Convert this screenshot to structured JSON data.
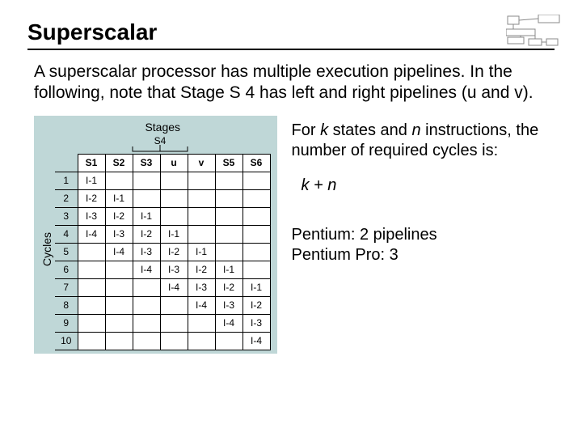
{
  "title": "Superscalar",
  "intro": "A superscalar processor has multiple execution pipelines. In the following, note that Stage S 4 has left and right pipelines (u and v).",
  "diagram": {
    "stages_label": "Stages",
    "cycles_label": "Cycles",
    "s4_label": "S4",
    "columns": [
      "S1",
      "S2",
      "S3",
      "u",
      "v",
      "S5",
      "S6"
    ],
    "cycles": [
      "1",
      "2",
      "3",
      "4",
      "5",
      "6",
      "7",
      "8",
      "9",
      "10"
    ],
    "cells": [
      [
        "I-1",
        "",
        "",
        "",
        "",
        "",
        ""
      ],
      [
        "I-2",
        "I-1",
        "",
        "",
        "",
        "",
        ""
      ],
      [
        "I-3",
        "I-2",
        "I-1",
        "",
        "",
        "",
        ""
      ],
      [
        "I-4",
        "I-3",
        "I-2",
        "I-1",
        "",
        "",
        ""
      ],
      [
        "",
        "I-4",
        "I-3",
        "I-2",
        "I-1",
        "",
        ""
      ],
      [
        "",
        "",
        "I-4",
        "I-3",
        "I-2",
        "I-1",
        ""
      ],
      [
        "",
        "",
        "",
        "I-4",
        "I-3",
        "I-2",
        "I-1"
      ],
      [
        "",
        "",
        "",
        "",
        "I-4",
        "I-3",
        "I-2"
      ],
      [
        "",
        "",
        "",
        "",
        "",
        "I-4",
        "I-3"
      ],
      [
        "",
        "",
        "",
        "",
        "",
        "",
        "I-4"
      ]
    ]
  },
  "side": {
    "p1a": "For ",
    "p1_k": "k",
    "p1b": " states and ",
    "p1_n": "n",
    "p1c": " instructions, the number of required cycles is:",
    "formula": "k + n",
    "pentium1": "Pentium: 2 pipelines",
    "pentium2": "Pentium Pro: 3"
  }
}
